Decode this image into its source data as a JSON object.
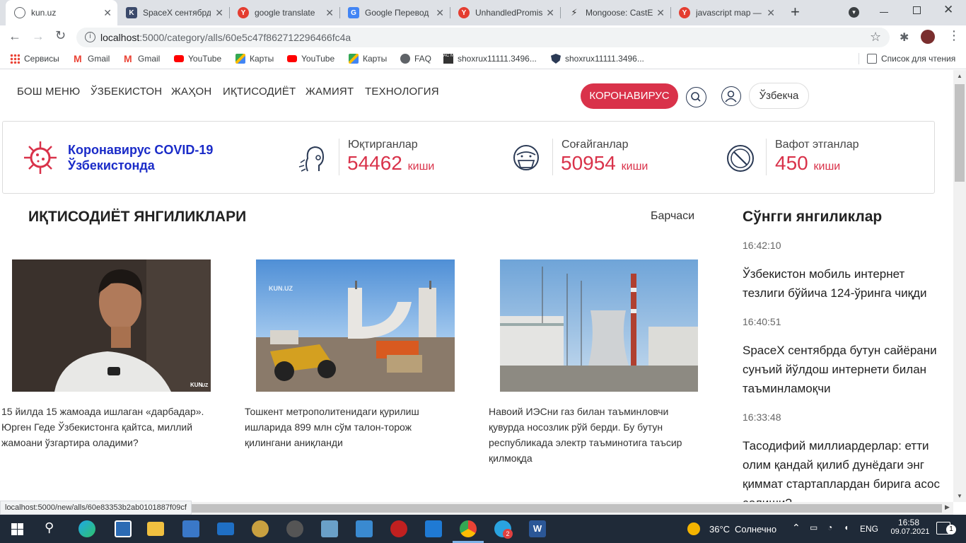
{
  "browser": {
    "tabs": [
      {
        "title": "kun.uz",
        "icon": "globe-icon",
        "color": "#5f6368",
        "active": true
      },
      {
        "title": "SpaceX сентябрд",
        "icon": "k-icon",
        "color": "#3b4a6b"
      },
      {
        "title": "google translate",
        "icon": "yandex-icon",
        "color": "#e43d30"
      },
      {
        "title": "Google Перевод",
        "icon": "google-translate-icon",
        "color": "#4285f4"
      },
      {
        "title": "UnhandledPromis",
        "icon": "yandex-icon",
        "color": "#e43d30"
      },
      {
        "title": "Mongoose: CastE",
        "icon": "bolt-icon",
        "color": "#333333"
      },
      {
        "title": "javascript map —",
        "icon": "yandex-icon",
        "color": "#e43d30"
      }
    ],
    "url_host": "localhost",
    "url_rest": ":5000/category/alls/60e5c47f862712296466fc4a",
    "bookmarks": [
      {
        "label": "Сервисы",
        "icon": "apps-grid-icon"
      },
      {
        "label": "Gmail",
        "icon": "gmail-icon"
      },
      {
        "label": "Gmail",
        "icon": "gmail-icon"
      },
      {
        "label": "YouTube",
        "icon": "youtube-icon"
      },
      {
        "label": "Карты",
        "icon": "maps-icon"
      },
      {
        "label": "YouTube",
        "icon": "youtube-icon"
      },
      {
        "label": "Карты",
        "icon": "maps-icon"
      },
      {
        "label": "FAQ",
        "icon": "globe-icon"
      },
      {
        "label": "shoxrux11111.3496...",
        "icon": "acmp-icon"
      },
      {
        "label": "shoxrux11111.3496...",
        "icon": "shield-icon"
      }
    ],
    "reading_list": "Список для чтения",
    "status_url": "localhost:5000/new/alls/60e83353b2ab0101887f09cf"
  },
  "site": {
    "nav": [
      "БОШ МЕНЮ",
      "ЎЗБЕКИСТОН",
      "ЖАҲОН",
      "ИҚТИСОДИЁТ",
      "ЖАМИЯТ",
      "ТЕХНОЛОГИЯ"
    ],
    "corona_button": "КОРОНАВИРУС",
    "lang_button": "Ўзбекча",
    "accent": "#d9324a",
    "covid": {
      "title_line1": "Коронавирус COVID-19",
      "title_line2": "Ўзбекистонда",
      "stats": [
        {
          "label": "Юқтирганлар",
          "value": "54462",
          "unit": "киши",
          "icon": "infected-person-icon"
        },
        {
          "label": "Соғайганлар",
          "value": "50954",
          "unit": "киши",
          "icon": "masked-person-icon"
        },
        {
          "label": "Вафот этганлар",
          "value": "450",
          "unit": "киши",
          "icon": "prohibited-icon"
        }
      ]
    },
    "section_title": "ИҚТИСОДИЁТ ЯНГИЛИКЛАРИ",
    "all_link": "Барчаси",
    "articles": [
      {
        "text": "15 йилда 15 жамоада ишлаган «дарбадар». Юрген Геде Ўзбекистонга қайтса, миллий жамоани ўзгартира оладими?",
        "image": "man-portrait-photo",
        "watermark": "KUN UZ"
      },
      {
        "text": "Тошкент метрополитенидаги қурилиш ишларида 899 млн сўм талон-торож қилингани аниқланди",
        "image": "construction-site-photo",
        "watermark": "KUN.UZ"
      },
      {
        "text": "Навоий ИЭСни газ билан таъминловчи қувурда носозлик рўй берди. Бу бутун республикада электр таъминотига таъсир қилмоқда",
        "image": "power-plant-photo"
      }
    ],
    "sidebar": {
      "title": "Сўнгги янгиликлар",
      "items": [
        {
          "time": "16:42:10",
          "text": "Ўзбекистон мобиль интернет тезлиги бўйича 124-ўринга чиқди"
        },
        {
          "time": "16:40:51",
          "text": "SpaceX сентябрда бутун сайёрани сунъий йўлдош интернети билан таъминламоқчи"
        },
        {
          "time": "16:33:48",
          "text": "Тасодифий миллиардерлар: етти олим қандай қилиб дунёдаги энг қиммат стартаплардан бирига асос солиши?"
        }
      ]
    }
  },
  "taskbar": {
    "weather": "36°C",
    "weather_text": "Солнечно",
    "lang": "ENG",
    "time": "16:58",
    "date": "09.07.2021",
    "telegram_badge": "2",
    "notification_count": "1"
  }
}
